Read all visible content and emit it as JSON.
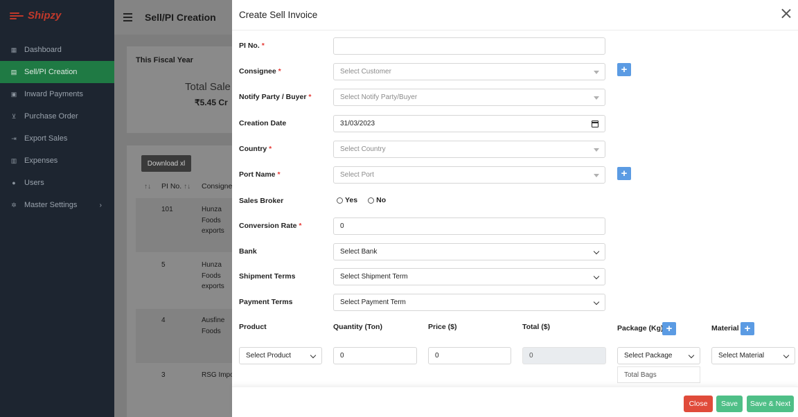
{
  "app": {
    "name": "Shipzy",
    "brand_color": "#c0392b",
    "accent_color": "#1f7a44"
  },
  "sidebar": {
    "items": [
      {
        "label": "Dashboard",
        "icon": "grid-icon"
      },
      {
        "label": "Sell/PI Creation",
        "icon": "document-icon",
        "active": true
      },
      {
        "label": "Inward Payments",
        "icon": "money-icon"
      },
      {
        "label": "Purchase Order",
        "icon": "cart-icon"
      },
      {
        "label": "Export Sales",
        "icon": "export-icon"
      },
      {
        "label": "Expenses",
        "icon": "expenses-icon"
      },
      {
        "label": "Users",
        "icon": "user-icon"
      },
      {
        "label": "Master Settings",
        "icon": "gear-icon",
        "chevron": "›"
      }
    ]
  },
  "page": {
    "title": "Sell/PI Creation",
    "fiscal_label": "This Fiscal Year",
    "total_sales_label": "Total Sale",
    "total_sales_value": "₹5.45 Cr",
    "download_label": "Download xl",
    "table": {
      "headers": [
        "PI No.",
        "Consignee"
      ],
      "rows": [
        {
          "pi": "101",
          "consignee": "Hunza Foods exports"
        },
        {
          "pi": "5",
          "consignee": "Hunza Foods exports"
        },
        {
          "pi": "4",
          "consignee": "Ausfine Foods"
        },
        {
          "pi": "3",
          "consignee": "RSG Impo"
        }
      ]
    }
  },
  "modal": {
    "title": "Create Sell Invoice",
    "fields": {
      "pi_no": {
        "label": "PI No.",
        "required": "*",
        "value": ""
      },
      "consignee": {
        "label": "Consignee",
        "required": "*",
        "placeholder": "Select Customer"
      },
      "notify_party": {
        "label": "Notify Party / Buyer",
        "required": "*",
        "placeholder": "Select Notify Party/Buyer"
      },
      "creation_date": {
        "label": "Creation Date",
        "value": "31/03/2023"
      },
      "country": {
        "label": "Country",
        "required": "*",
        "placeholder": "Select Country"
      },
      "port_name": {
        "label": "Port Name",
        "required": "*",
        "placeholder": "Select Port"
      },
      "sales_broker": {
        "label": "Sales Broker",
        "options": [
          "Yes",
          "No"
        ]
      },
      "conversion_rate": {
        "label": "Conversion Rate",
        "required": "*",
        "value": "0"
      },
      "bank": {
        "label": "Bank",
        "value": "Select Bank"
      },
      "shipment_terms": {
        "label": "Shipment Terms",
        "value": "Select Shipment Term"
      },
      "payment_terms": {
        "label": "Payment Terms",
        "value": "Select Payment Term"
      }
    },
    "items": {
      "headers": {
        "product": "Product",
        "quantity": "Quantity (Ton)",
        "price": "Price ($)",
        "total": "Total ($)",
        "package": "Package (Kg)",
        "material": "Material"
      },
      "product": "Select Product",
      "quantity": "0",
      "price": "0",
      "total": "0",
      "package": "Select Package",
      "package_option": "Total Bags",
      "material": "Select Material"
    },
    "add_symbol": "+",
    "footer": {
      "close": "Close",
      "save": "Save",
      "save_next": "Save & Next"
    }
  }
}
